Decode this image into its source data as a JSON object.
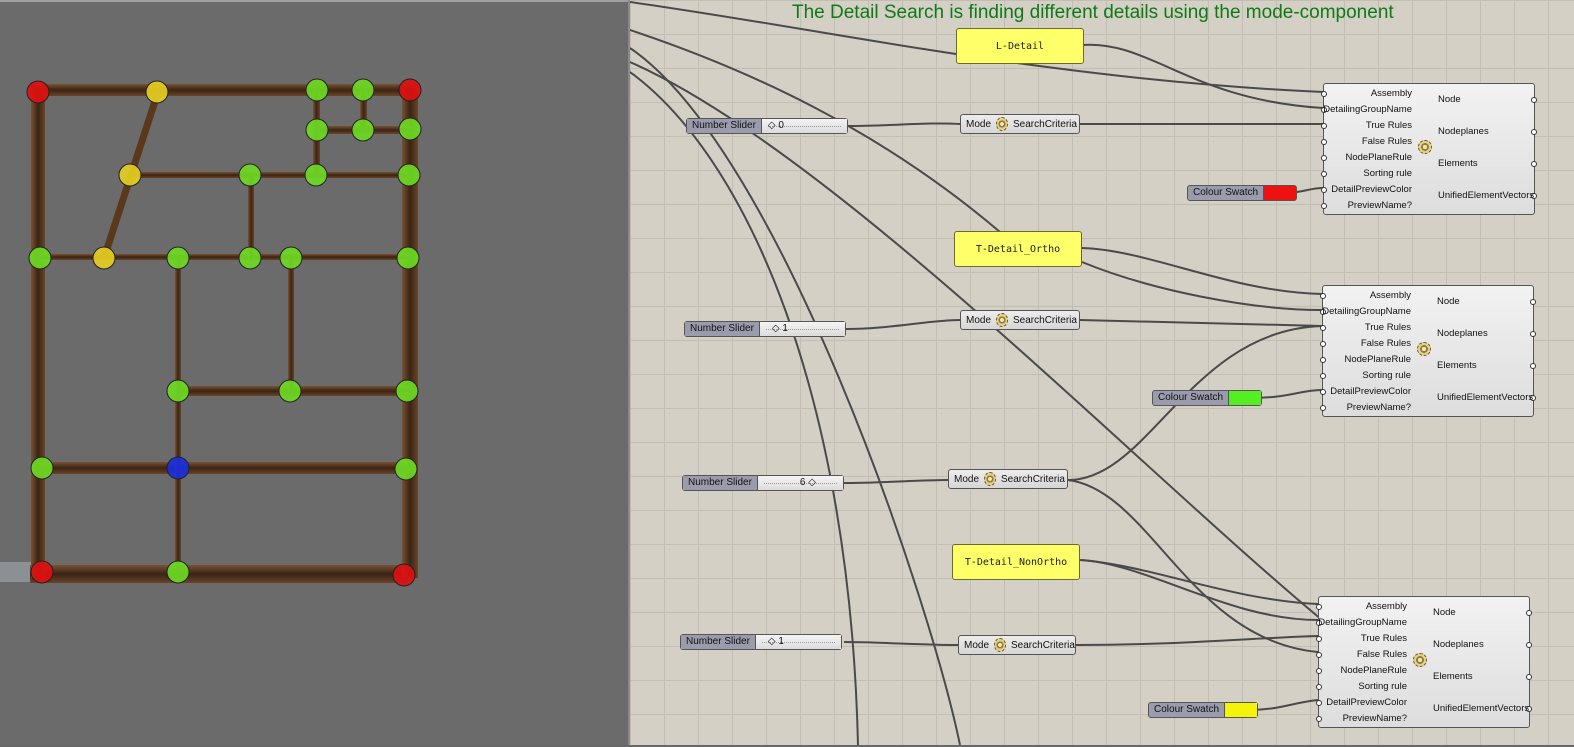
{
  "viewport": {
    "nodes": [
      {
        "label": "node",
        "color": "#e01010"
      },
      {
        "label": "node",
        "color": "#e8d020"
      },
      {
        "label": "node",
        "color": "#6edd22"
      }
    ]
  },
  "canvas": {
    "title": "The Detail Search is finding different details using the mode-component",
    "panels": [
      "L-Detail",
      "T-Detail_Ortho",
      "T-Detail_NonOrtho"
    ],
    "sliders": [
      {
        "label": "Number Slider",
        "value": "0"
      },
      {
        "label": "Number Slider",
        "value": "1"
      },
      {
        "label": "Number Slider",
        "value": "6"
      },
      {
        "label": "Number Slider",
        "value": "1"
      }
    ],
    "mode_components": [
      {
        "mode": "Mode",
        "criteria": "SearchCriteria"
      },
      {
        "mode": "Mode",
        "criteria": "SearchCriteria"
      },
      {
        "mode": "Mode",
        "criteria": "SearchCriteria"
      },
      {
        "mode": "Mode",
        "criteria": "SearchCriteria"
      }
    ],
    "swatches": [
      {
        "label": "Colour Swatch",
        "color": "#ee1111"
      },
      {
        "label": "Colour Swatch",
        "color": "#55ee22"
      },
      {
        "label": "Colour Swatch",
        "color": "#f4f40a"
      }
    ],
    "detail_inputs": [
      "Assembly",
      "DetailingGroupName",
      "True Rules",
      "False Rules",
      "NodePlaneRule",
      "Sorting rule",
      "DetailPreviewColor",
      "PreviewName?"
    ],
    "detail_outputs": [
      "Node",
      "Nodeplanes",
      "Elements",
      "UnifiedElementVectors"
    ]
  }
}
